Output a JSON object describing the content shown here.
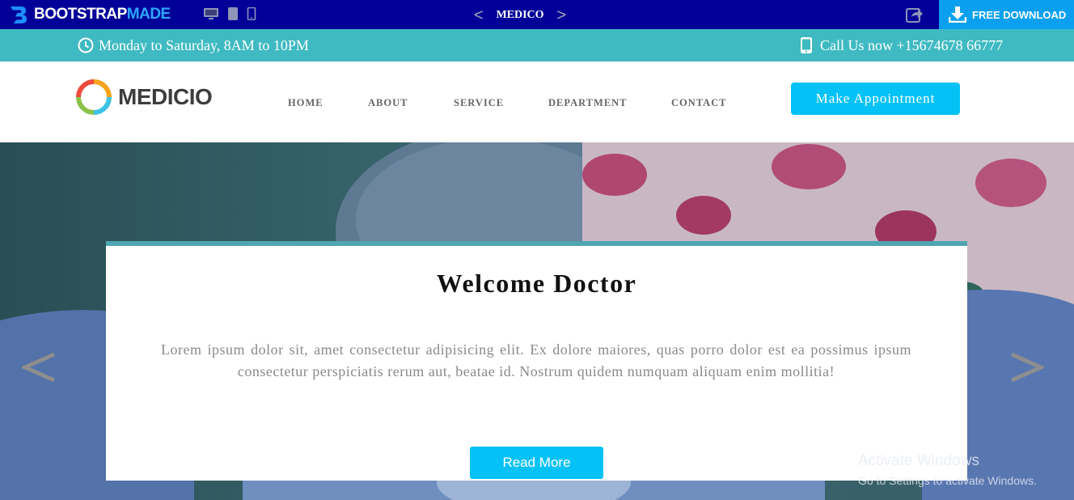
{
  "preview_bar": {
    "brand_primary": "BOOTSTRAP",
    "brand_accent": "MADE",
    "theme_name": "MEDICO",
    "prev_arrow": "<",
    "next_arrow": ">",
    "download_label": "FREE DOWNLOAD",
    "device_icons": [
      "desktop-icon",
      "tablet-icon",
      "mobile-icon"
    ]
  },
  "info_bar": {
    "hours": "Monday to Saturday, 8AM to 10PM",
    "phone": "Call Us now +15674678 66777"
  },
  "nav": {
    "logo_text": "MEDICIO",
    "items": [
      {
        "label": "HOME"
      },
      {
        "label": "ABOUT"
      },
      {
        "label": "SERVICE"
      },
      {
        "label": "DEPARTMENT"
      },
      {
        "label": "CONTACT"
      }
    ],
    "cta": "Make Appointment"
  },
  "hero": {
    "title": "Welcome Doctor",
    "text": "Lorem ipsum dolor sit, amet consectetur adipisicing elit. Ex dolore maiores, quas porro dolor est ea possimus ipsum consectetur perspiciatis rerum aut, beatae id. Nostrum quidem numquam aliquam enim mollitia!",
    "button": "Read More"
  },
  "watermark": {
    "line1": "Activate Windows",
    "line2": "Go to Settings to activate Windows."
  },
  "colors": {
    "preview_bar": "#000099",
    "download": "#0aa0ef",
    "info_bar": "#3fbac2",
    "accent_button": "#04c2f5",
    "card_top_border": "#4fa6b1"
  }
}
